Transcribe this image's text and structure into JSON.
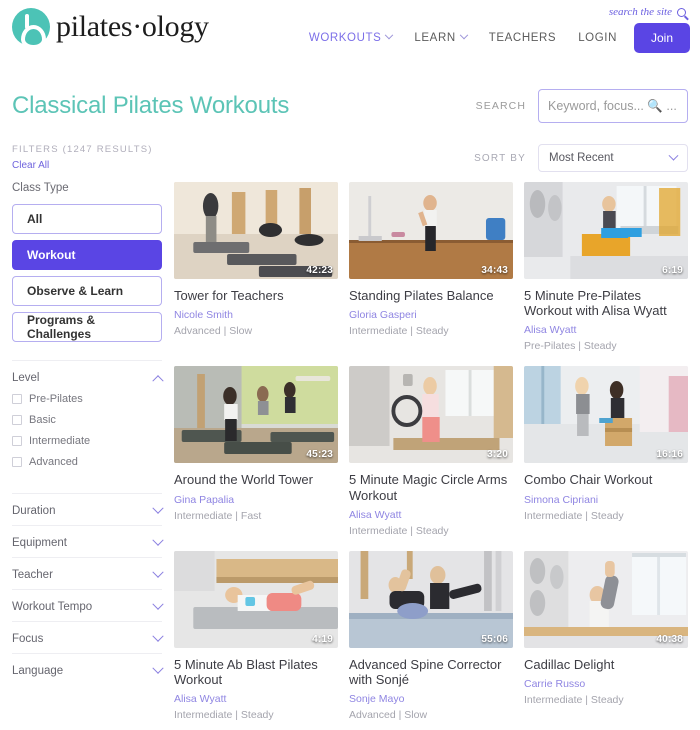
{
  "header": {
    "logo_text": "pilates·ology",
    "search_site_label": "search the site",
    "nav": [
      {
        "label": "WORKOUTS",
        "has_chevron": true,
        "active": true
      },
      {
        "label": "LEARN",
        "has_chevron": true,
        "active": false
      },
      {
        "label": "TEACHERS",
        "has_chevron": false,
        "active": false
      },
      {
        "label": "LOGIN",
        "has_chevron": false,
        "active": false
      }
    ],
    "join_label": "Join"
  },
  "page": {
    "title": "Classical Pilates Workouts",
    "search_label": "SEARCH",
    "search_placeholder": "Keyword, focus... 🔍 ...",
    "search_value": ""
  },
  "filters": {
    "heading": "FILTERS (1247 RESULTS)",
    "clear_all": "Clear All",
    "class_type_label": "Class Type",
    "class_types": [
      {
        "label": "All",
        "selected": false
      },
      {
        "label": "Workout",
        "selected": true
      },
      {
        "label": "Observe & Learn",
        "selected": false
      },
      {
        "label": "Programs & Challenges",
        "selected": false
      }
    ],
    "level": {
      "label": "Level",
      "expanded": true,
      "options": [
        {
          "label": "Pre-Pilates",
          "checked": false
        },
        {
          "label": "Basic",
          "checked": false
        },
        {
          "label": "Intermediate",
          "checked": false
        },
        {
          "label": "Advanced",
          "checked": false
        }
      ]
    },
    "collapsed_groups": [
      {
        "label": "Duration"
      },
      {
        "label": "Equipment"
      },
      {
        "label": "Teacher"
      },
      {
        "label": "Workout Tempo"
      },
      {
        "label": "Focus"
      },
      {
        "label": "Language"
      }
    ]
  },
  "sort": {
    "label": "SORT BY",
    "value": "Most Recent"
  },
  "results": [
    {
      "title": "Tower for Teachers",
      "teacher": "Nicole Smith",
      "meta": "Advanced | Slow",
      "duration": "42:23",
      "thumb": "tower-teachers"
    },
    {
      "title": "Standing Pilates Balance",
      "teacher": "Gloria Gasperi",
      "meta": "Intermediate | Steady",
      "duration": "34:43",
      "thumb": "standing-balance"
    },
    {
      "title": "5 Minute Pre-Pilates Workout with Alisa Wyatt",
      "teacher": "Alisa Wyatt",
      "meta": "Pre-Pilates | Steady",
      "duration": "6:19",
      "thumb": "pre-pilates"
    },
    {
      "title": "Around the World Tower",
      "teacher": "Gina Papalia",
      "meta": "Intermediate | Fast",
      "duration": "45:23",
      "thumb": "around-world"
    },
    {
      "title": "5 Minute Magic Circle Arms Workout",
      "teacher": "Alisa Wyatt",
      "meta": "Intermediate | Steady",
      "duration": "3:20",
      "thumb": "magic-circle"
    },
    {
      "title": "Combo Chair Workout",
      "teacher": "Simona Cipriani",
      "meta": "Intermediate | Steady",
      "duration": "16:16",
      "thumb": "combo-chair"
    },
    {
      "title": "5 Minute Ab Blast Pilates Workout",
      "teacher": "Alisa Wyatt",
      "meta": "Intermediate | Steady",
      "duration": "4:19",
      "thumb": "ab-blast"
    },
    {
      "title": "Advanced Spine Corrector with Sonjé",
      "teacher": "Sonje Mayo",
      "meta": "Advanced | Slow",
      "duration": "55:06",
      "thumb": "spine-corrector"
    },
    {
      "title": "Cadillac Delight",
      "teacher": "Carrie Russo",
      "meta": "Intermediate | Steady",
      "duration": "40:38",
      "thumb": "cadillac-delight"
    }
  ],
  "colors": {
    "brand_teal": "#5cc4b6",
    "accent_purple": "#5a45e4",
    "link_purple": "#8f85e2",
    "text_dark": "#3d3d44",
    "text_muted": "#a4a4ad"
  }
}
